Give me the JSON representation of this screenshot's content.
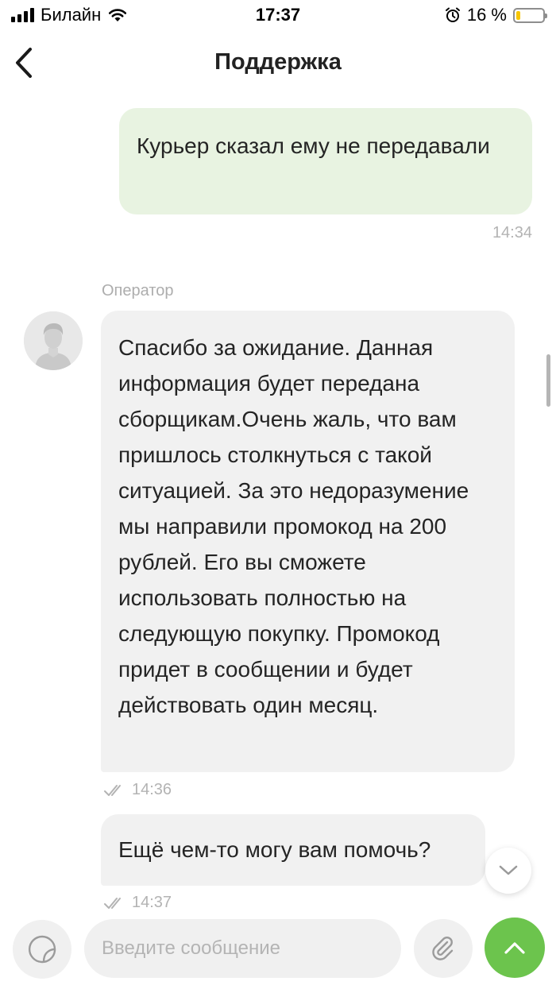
{
  "status_bar": {
    "carrier": "Билайн",
    "time": "17:37",
    "battery_text": "16 %",
    "battery_level": 0.16
  },
  "header": {
    "title": "Поддержка"
  },
  "messages": [
    {
      "direction": "outgoing",
      "text": "Курьер сказал ему не передавали",
      "time": "14:34"
    },
    {
      "direction": "incoming",
      "sender": "Оператор",
      "text": "Спасибо за ожидание. Данная информация будет передана сборщикам.Очень жаль, что вам пришлось столкнуться с такой ситуацией. За это недоразумение мы направили промокод на 200 рублей. Его вы сможете использовать полностью на следующую покупку. Промокод придет в сообщении и будет действовать один месяц.",
      "time": "14:36",
      "read_icon": "double-check-icon"
    },
    {
      "direction": "incoming",
      "text": "Ещё чем-то могу вам помочь?",
      "time": "14:37",
      "read_icon": "double-check-icon"
    }
  ],
  "composer": {
    "placeholder": "Введите сообщение",
    "value": ""
  },
  "icons": {
    "back": "chevron-left-icon",
    "sticker": "sticker-icon",
    "attach": "paperclip-icon",
    "send": "chevron-up-icon",
    "scroll_down": "chevron-down-icon"
  },
  "colors": {
    "outgoing_bubble": "#e8f3e1",
    "incoming_bubble": "#f1f1f1",
    "send_button": "#6cc44d",
    "battery_fill": "#f7c600"
  }
}
